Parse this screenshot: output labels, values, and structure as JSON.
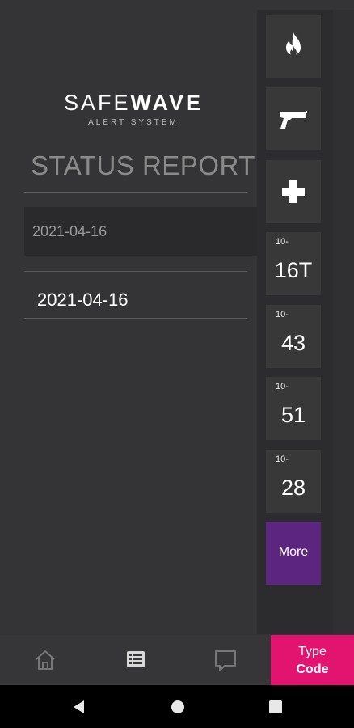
{
  "app": {
    "brand_word_thin": "SAFE",
    "brand_word_bold": "WAVE",
    "brand_subtitle": "ALERT SYSTEM",
    "accent_color": "#e3146f",
    "more_color": "#5c2580"
  },
  "main": {
    "title": "STATUS REPORT",
    "selected_date": "2021-04-16",
    "dates": [
      "2021-04-16"
    ]
  },
  "alerts": {
    "icons": [
      {
        "name": "fire-icon"
      },
      {
        "name": "gun-icon"
      },
      {
        "name": "medical-cross-icon"
      }
    ],
    "codes": [
      {
        "prefix": "10-",
        "code": "16T"
      },
      {
        "prefix": "10-",
        "code": "43"
      },
      {
        "prefix": "10-",
        "code": "51"
      },
      {
        "prefix": "10-",
        "code": "28"
      }
    ],
    "more_label": "More"
  },
  "bottom_nav": {
    "items": [
      {
        "name": "home-icon"
      },
      {
        "name": "list-icon"
      },
      {
        "name": "chat-icon"
      }
    ],
    "type_code_line1": "Type",
    "type_code_line2": "Code"
  },
  "system_nav": {
    "items": [
      {
        "name": "back-icon"
      },
      {
        "name": "home-circle-icon"
      },
      {
        "name": "recents-icon"
      }
    ]
  }
}
